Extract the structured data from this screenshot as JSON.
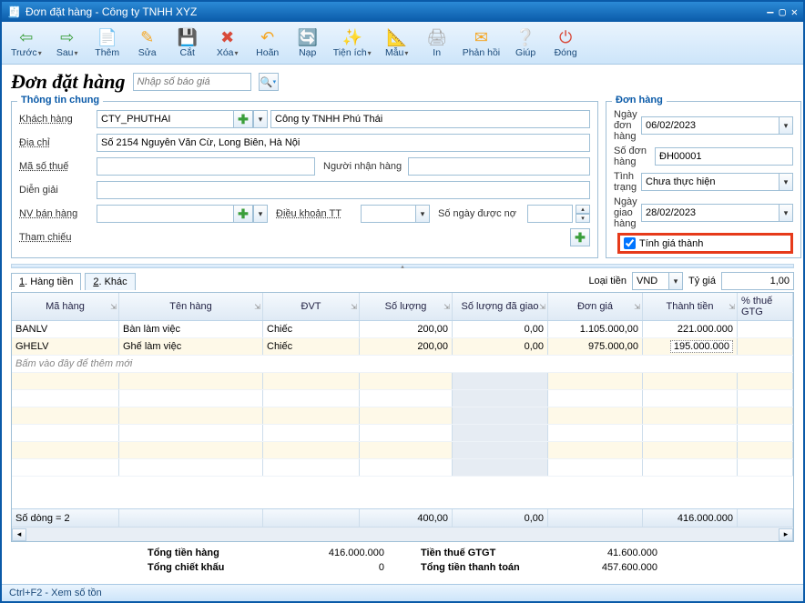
{
  "window": {
    "title": "Đơn đặt hàng - Công ty TNHH XYZ"
  },
  "toolbar": {
    "back": "Trước",
    "forward": "Sau",
    "add": "Thêm",
    "edit": "Sửa",
    "cut": "Cắt",
    "delete": "Xóa",
    "undo": "Hoãn",
    "load": "Nạp",
    "util": "Tiện ích",
    "template": "Mẫu",
    "print": "In",
    "feedback": "Phản hồi",
    "help": "Giúp",
    "close": "Đóng"
  },
  "page_title": "Đơn đặt hàng",
  "quote_placeholder": "Nhập số báo giá",
  "general": {
    "legend": "Thông tin chung",
    "customer_label": "Khách hàng",
    "customer_code": "CTY_PHUTHAI",
    "customer_name": "Công ty TNHH Phú Thái",
    "address_label": "Địa chỉ",
    "address": "Số 2154 Nguyễn Văn Cừ, Long Biên, Hà Nội",
    "tax_label": "Mã số thuế",
    "tax": "",
    "receiver_label": "Người nhận hàng",
    "receiver": "",
    "note_label": "Diễn giải",
    "note": "",
    "sales_label": "NV bán hàng",
    "sales": "",
    "terms_label": "Điều khoản TT",
    "terms": "",
    "debtdays_label": "Số ngày được nợ",
    "debtdays": "",
    "ref_label": "Tham chiếu"
  },
  "order": {
    "legend": "Đơn hàng",
    "date_label": "Ngày đơn hàng",
    "date": "06/02/2023",
    "no_label": "Số đơn hàng",
    "no": "ĐH00001",
    "status_label": "Tình trạng",
    "status": "Chưa thực hiện",
    "delivery_label": "Ngày giao hàng",
    "delivery": "28/02/2023",
    "calc_label": "Tính giá thành"
  },
  "tabs": {
    "t1_u": "1",
    "t1": ". Hàng tiền",
    "t2_u": "2",
    "t2": ". Khác",
    "currency_label": "Loại tiền",
    "currency": "VND",
    "rate_label": "Tỷ giá",
    "rate": "1,00"
  },
  "grid": {
    "h": {
      "code": "Mã hàng",
      "name": "Tên hàng",
      "unit": "ĐVT",
      "qty": "Số lượng",
      "delivered": "Số lượng đã giao",
      "price": "Đơn giá",
      "amount": "Thành tiền",
      "vat": "% thuế GTG"
    },
    "rows": [
      {
        "code": "BANLV",
        "name": "Bàn làm việc",
        "unit": "Chiếc",
        "qty": "200,00",
        "delivered": "0,00",
        "price": "1.105.000,00",
        "amount": "221.000.000"
      },
      {
        "code": "GHELV",
        "name": "Ghế làm việc",
        "unit": "Chiếc",
        "qty": "200,00",
        "delivered": "0,00",
        "price": "975.000,00",
        "amount": "195.000.000"
      }
    ],
    "newrow": "Bấm vào đây để thêm mới",
    "footer": {
      "rowcount": "Số dòng = 2",
      "qty": "400,00",
      "delivered": "0,00",
      "amount": "416.000.000"
    }
  },
  "totals": {
    "subtotal_label": "Tổng tiền hàng",
    "subtotal": "416.000.000",
    "discount_label": "Tổng chiết khấu",
    "discount": "0",
    "vat_label": "Tiền thuế GTGT",
    "vat": "41.600.000",
    "total_label": "Tổng tiền thanh toán",
    "total": "457.600.000"
  },
  "status": "Ctrl+F2 - Xem số tồn"
}
